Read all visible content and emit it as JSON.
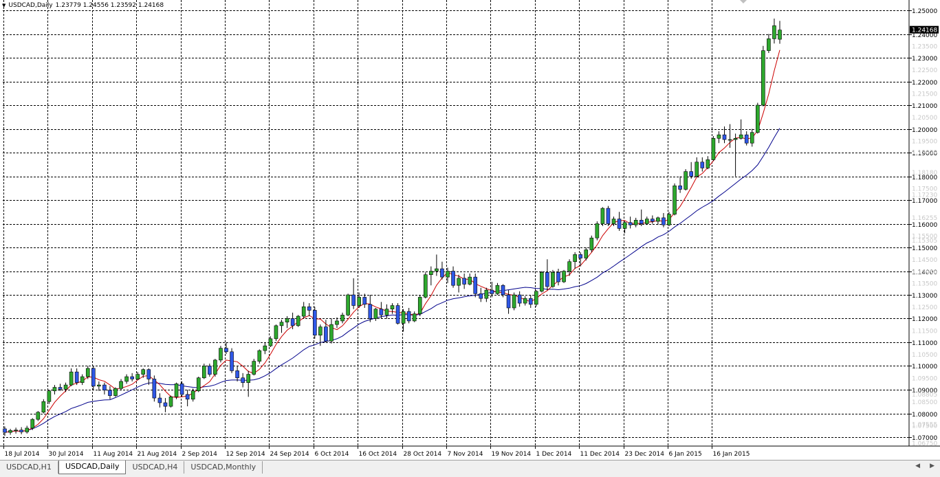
{
  "header": {
    "menu_icon": "dropdown-triangle-icon",
    "symbol": "USDCAD,Daily",
    "ohlc": "1.23779 1.24556 1.23592 1.24168"
  },
  "tabs": [
    {
      "label": "USDCAD,H1",
      "active": false
    },
    {
      "label": "USDCAD,Daily",
      "active": true
    },
    {
      "label": "USDCAD,H4",
      "active": false
    },
    {
      "label": "USDCAD,Monthly",
      "active": false
    }
  ],
  "colors": {
    "bull": "#2ea82e",
    "bear": "#2f57e6",
    "ma_fast": "#cc0000",
    "ma_slow": "#00008b",
    "grid": "#000000",
    "background": "#ffffff"
  },
  "chart_data": {
    "type": "candlestick",
    "symbol": "USDCAD",
    "timeframe": "Daily",
    "ylim": [
      1.0675,
      1.253
    ],
    "grid": true,
    "price_labels": [
      "1.25000",
      "1.24000",
      "1.23000",
      "1.22000",
      "1.21000",
      "1.20000",
      "1.19000",
      "1.18000",
      "1.17000",
      "1.16000",
      "1.15000",
      "1.14000",
      "1.13000",
      "1.12000",
      "1.11000",
      "1.10000",
      "1.09000",
      "1.08000",
      "1.07000"
    ],
    "price_label_values": [
      1.25,
      1.24,
      1.23,
      1.22,
      1.21,
      1.2,
      1.19,
      1.18,
      1.17,
      1.16,
      1.15,
      1.14,
      1.13,
      1.12,
      1.11,
      1.1,
      1.09,
      1.08,
      1.07
    ],
    "faint_price_labels": [
      "1.24168",
      "1.23500",
      "1.22500",
      "1.21500",
      "1.20500",
      "1.19500",
      "1.19030",
      "1.18180",
      "1.17500",
      "1.17230",
      "1.16255",
      "1.15500",
      "1.15305",
      "1.14500",
      "1.13950",
      "1.13500",
      "1.12500",
      "1.11500",
      "1.10500",
      "1.09500",
      "1.08805",
      "1.08500",
      "1.07555",
      "1.07500",
      "1.06750"
    ],
    "faint_price_label_values": [
      1.24168,
      1.235,
      1.225,
      1.215,
      1.205,
      1.195,
      1.1903,
      1.1818,
      1.175,
      1.1723,
      1.16255,
      1.155,
      1.15305,
      1.145,
      1.1395,
      1.135,
      1.125,
      1.115,
      1.105,
      1.095,
      1.08805,
      1.085,
      1.07555,
      1.075,
      1.0675
    ],
    "time_labels": [
      "18 Jul 2014",
      "30 Jul 2014",
      "11 Aug 2014",
      "21 Aug 2014",
      "2 Sep 2014",
      "12 Sep 2014",
      "24 Sep 2014",
      "6 Oct 2014",
      "16 Oct 2014",
      "28 Oct 2014",
      "7 Nov 2014",
      "19 Nov 2014",
      "1 Dec 2014",
      "11 Dec 2014",
      "23 Dec 2014",
      "6 Jan 2015",
      "16 Jan 2015"
    ],
    "time_label_bars": [
      0,
      8,
      16,
      24,
      32,
      40,
      48,
      56,
      64,
      72,
      80,
      88,
      96,
      104,
      112,
      120,
      128
    ],
    "candles": [
      [
        1.0735,
        1.0745,
        1.0705,
        1.072
      ],
      [
        1.072,
        1.0735,
        1.071,
        1.0728
      ],
      [
        1.0728,
        1.074,
        1.0715,
        1.073
      ],
      [
        1.073,
        1.0742,
        1.0712,
        1.0722
      ],
      [
        1.0722,
        1.0748,
        1.0715,
        1.0738
      ],
      [
        1.0738,
        1.078,
        1.073,
        1.0775
      ],
      [
        1.0775,
        1.081,
        1.0768,
        1.0805
      ],
      [
        1.0805,
        1.086,
        1.08,
        1.085
      ],
      [
        1.085,
        1.09,
        1.084,
        1.0895
      ],
      [
        1.0895,
        1.092,
        1.088,
        1.091
      ],
      [
        1.091,
        1.0925,
        1.0895,
        1.0902
      ],
      [
        1.0902,
        1.093,
        1.089,
        1.092
      ],
      [
        1.092,
        1.099,
        1.0915,
        1.0975
      ],
      [
        1.0975,
        1.099,
        1.092,
        1.093
      ],
      [
        1.093,
        1.0965,
        1.092,
        1.0955
      ],
      [
        1.0955,
        1.1,
        1.0945,
        1.099
      ],
      [
        1.099,
        1.1,
        1.09,
        1.0915
      ],
      [
        1.0915,
        1.0935,
        1.0895,
        1.092
      ],
      [
        1.092,
        1.093,
        1.088,
        1.0898
      ],
      [
        1.0898,
        1.0915,
        1.086,
        1.0875
      ],
      [
        1.0875,
        1.091,
        1.087,
        1.0905
      ],
      [
        1.0905,
        1.0945,
        1.09,
        1.0935
      ],
      [
        1.0935,
        1.0965,
        1.0925,
        1.0955
      ],
      [
        1.0955,
        1.097,
        1.0935,
        1.0945
      ],
      [
        1.0945,
        1.0975,
        1.094,
        1.0965
      ],
      [
        1.0965,
        1.099,
        1.095,
        1.0985
      ],
      [
        1.0985,
        1.099,
        1.092,
        1.0945
      ],
      [
        1.0945,
        1.096,
        1.085,
        1.0865
      ],
      [
        1.0865,
        1.0885,
        1.0825,
        1.0845
      ],
      [
        1.0845,
        1.0865,
        1.0805,
        1.083
      ],
      [
        1.083,
        1.0875,
        1.0825,
        1.087
      ],
      [
        1.087,
        1.093,
        1.086,
        1.0925
      ],
      [
        1.0925,
        1.0935,
        1.087,
        1.088
      ],
      [
        1.088,
        1.09,
        1.083,
        1.086
      ],
      [
        1.086,
        1.0905,
        1.085,
        1.0895
      ],
      [
        1.0895,
        1.0955,
        1.089,
        1.095
      ],
      [
        1.095,
        1.101,
        1.0945,
        1.1
      ],
      [
        1.1,
        1.101,
        1.0955,
        1.0965
      ],
      [
        1.0965,
        1.103,
        1.0955,
        1.1025
      ],
      [
        1.1025,
        1.1085,
        1.1015,
        1.1075
      ],
      [
        1.1075,
        1.11,
        1.105,
        1.106
      ],
      [
        1.106,
        1.1075,
        1.097,
        1.098
      ],
      [
        1.098,
        1.1,
        1.0935,
        1.095
      ],
      [
        1.095,
        1.097,
        1.091,
        1.093
      ],
      [
        1.093,
        1.098,
        1.087,
        1.0965
      ],
      [
        1.0965,
        1.103,
        1.096,
        1.102
      ],
      [
        1.102,
        1.107,
        1.101,
        1.1065
      ],
      [
        1.1065,
        1.11,
        1.105,
        1.1085
      ],
      [
        1.1085,
        1.1125,
        1.108,
        1.1115
      ],
      [
        1.1115,
        1.1175,
        1.1105,
        1.117
      ],
      [
        1.117,
        1.1195,
        1.114,
        1.1185
      ],
      [
        1.1185,
        1.121,
        1.116,
        1.12
      ],
      [
        1.12,
        1.1225,
        1.1155,
        1.117
      ],
      [
        1.117,
        1.1215,
        1.1165,
        1.121
      ],
      [
        1.121,
        1.127,
        1.12,
        1.125
      ],
      [
        1.125,
        1.1265,
        1.121,
        1.1235
      ],
      [
        1.1235,
        1.125,
        1.1115,
        1.113
      ],
      [
        1.113,
        1.1175,
        1.1085,
        1.1165
      ],
      [
        1.1165,
        1.1195,
        1.11,
        1.1105
      ],
      [
        1.1105,
        1.12,
        1.1095,
        1.1175
      ],
      [
        1.1175,
        1.1205,
        1.116,
        1.119
      ],
      [
        1.119,
        1.1225,
        1.118,
        1.1215
      ],
      [
        1.1215,
        1.1305,
        1.121,
        1.13
      ],
      [
        1.13,
        1.137,
        1.124,
        1.1255
      ],
      [
        1.1255,
        1.131,
        1.1245,
        1.129
      ],
      [
        1.129,
        1.1305,
        1.1245,
        1.126
      ],
      [
        1.126,
        1.13,
        1.1185,
        1.12
      ],
      [
        1.12,
        1.1245,
        1.119,
        1.124
      ],
      [
        1.124,
        1.127,
        1.12,
        1.1215
      ],
      [
        1.1215,
        1.126,
        1.12,
        1.124
      ],
      [
        1.124,
        1.1265,
        1.122,
        1.1255
      ],
      [
        1.1255,
        1.1265,
        1.1175,
        1.118
      ],
      [
        1.118,
        1.124,
        1.1145,
        1.123
      ],
      [
        1.123,
        1.1245,
        1.118,
        1.119
      ],
      [
        1.119,
        1.123,
        1.1185,
        1.122
      ],
      [
        1.122,
        1.13,
        1.121,
        1.129
      ],
      [
        1.129,
        1.1395,
        1.1285,
        1.1385
      ],
      [
        1.1385,
        1.142,
        1.134,
        1.14
      ],
      [
        1.14,
        1.147,
        1.138,
        1.141
      ],
      [
        1.141,
        1.144,
        1.1365,
        1.1375
      ],
      [
        1.1375,
        1.1415,
        1.135,
        1.14
      ],
      [
        1.14,
        1.142,
        1.133,
        1.134
      ],
      [
        1.134,
        1.1385,
        1.131,
        1.137
      ],
      [
        1.137,
        1.139,
        1.1325,
        1.1345
      ],
      [
        1.1345,
        1.139,
        1.134,
        1.1375
      ],
      [
        1.1375,
        1.139,
        1.129,
        1.1305
      ],
      [
        1.1305,
        1.133,
        1.127,
        1.1285
      ],
      [
        1.1285,
        1.133,
        1.127,
        1.132
      ],
      [
        1.132,
        1.1355,
        1.129,
        1.1305
      ],
      [
        1.1305,
        1.135,
        1.13,
        1.134
      ],
      [
        1.134,
        1.1345,
        1.129,
        1.13
      ],
      [
        1.13,
        1.132,
        1.122,
        1.1245
      ],
      [
        1.1245,
        1.131,
        1.1235,
        1.13
      ],
      [
        1.13,
        1.1315,
        1.125,
        1.1265
      ],
      [
        1.1265,
        1.1295,
        1.1255,
        1.1285
      ],
      [
        1.1285,
        1.13,
        1.1245,
        1.126
      ],
      [
        1.126,
        1.132,
        1.125,
        1.1315
      ],
      [
        1.1315,
        1.14,
        1.131,
        1.1395
      ],
      [
        1.1395,
        1.145,
        1.132,
        1.1335
      ],
      [
        1.1335,
        1.1405,
        1.133,
        1.1395
      ],
      [
        1.1395,
        1.141,
        1.134,
        1.1355
      ],
      [
        1.1355,
        1.1405,
        1.135,
        1.14
      ],
      [
        1.14,
        1.145,
        1.138,
        1.144
      ],
      [
        1.144,
        1.148,
        1.141,
        1.147
      ],
      [
        1.147,
        1.148,
        1.142,
        1.1455
      ],
      [
        1.1455,
        1.15,
        1.1445,
        1.149
      ],
      [
        1.149,
        1.155,
        1.148,
        1.154
      ],
      [
        1.154,
        1.161,
        1.153,
        1.16
      ],
      [
        1.16,
        1.167,
        1.159,
        1.1665
      ],
      [
        1.1665,
        1.1675,
        1.159,
        1.16
      ],
      [
        1.16,
        1.163,
        1.159,
        1.162
      ],
      [
        1.162,
        1.165,
        1.157,
        1.158
      ],
      [
        1.158,
        1.161,
        1.156,
        1.1605
      ],
      [
        1.1605,
        1.163,
        1.158,
        1.1595
      ],
      [
        1.1595,
        1.1625,
        1.1585,
        1.1615
      ],
      [
        1.1615,
        1.166,
        1.159,
        1.16
      ],
      [
        1.16,
        1.163,
        1.1595,
        1.162
      ],
      [
        1.162,
        1.1635,
        1.16,
        1.161
      ],
      [
        1.161,
        1.163,
        1.1595,
        1.1625
      ],
      [
        1.1625,
        1.1645,
        1.1585,
        1.1595
      ],
      [
        1.1595,
        1.165,
        1.159,
        1.164
      ],
      [
        1.164,
        1.177,
        1.1635,
        1.176
      ],
      [
        1.176,
        1.18,
        1.173,
        1.1745
      ],
      [
        1.1745,
        1.183,
        1.174,
        1.182
      ],
      [
        1.182,
        1.186,
        1.179,
        1.18
      ],
      [
        1.18,
        1.188,
        1.1795,
        1.186
      ],
      [
        1.186,
        1.188,
        1.182,
        1.1835
      ],
      [
        1.1835,
        1.1885,
        1.183,
        1.187
      ],
      [
        1.187,
        1.197,
        1.1865,
        1.196
      ],
      [
        1.196,
        1.199,
        1.194,
        1.1975
      ],
      [
        1.1975,
        1.201,
        1.194,
        1.1955
      ],
      [
        1.1955,
        1.202,
        1.192,
        1.1955
      ],
      [
        1.1955,
        1.198,
        1.18,
        1.196
      ],
      [
        1.196,
        1.204,
        1.1955,
        1.1975
      ],
      [
        1.1975,
        1.199,
        1.193,
        1.194
      ],
      [
        1.194,
        1.2,
        1.1925,
        1.1985
      ],
      [
        1.1985,
        1.211,
        1.198,
        1.21
      ],
      [
        1.21,
        1.235,
        1.2095,
        1.233
      ],
      [
        1.233,
        1.24,
        1.232,
        1.238
      ],
      [
        1.238,
        1.2465,
        1.236,
        1.2435
      ],
      [
        1.23779,
        1.24556,
        1.23592,
        1.24168
      ]
    ],
    "ma_fast_period": 5,
    "ma_slow_period": 20
  }
}
